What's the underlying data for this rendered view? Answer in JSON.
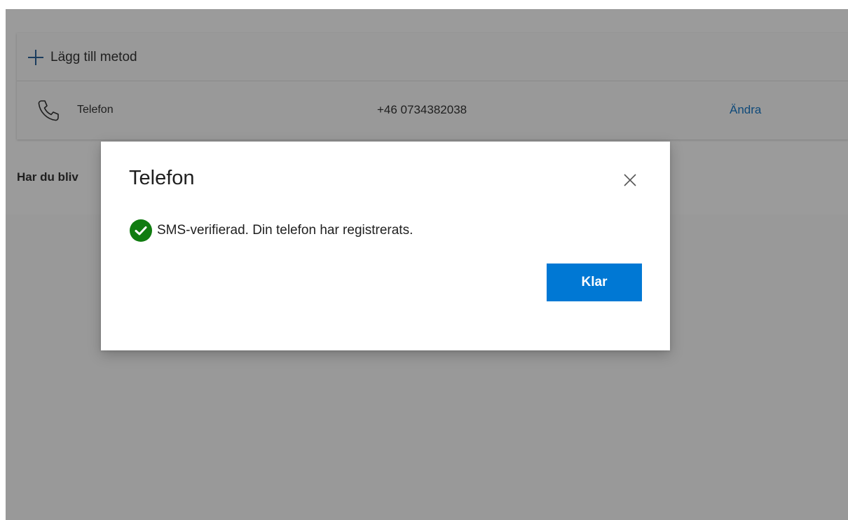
{
  "methods": {
    "add_method_label": "Lägg till metod",
    "rows": [
      {
        "name": "Telefon",
        "value": "+46 0734382038",
        "action": "Ändra",
        "icon": "phone-icon"
      }
    ]
  },
  "lost_device_text": "Har du bliv",
  "dialog": {
    "title": "Telefon",
    "close_icon": "close-icon",
    "status_icon": "checkmark-circle-icon",
    "status_text": "SMS-verifierad. Din telefon har registrerats.",
    "done_label": "Klar"
  },
  "colors": {
    "accent": "#0078d4",
    "success": "#107c10",
    "overlay": "#999999",
    "link": "#0f4a7a"
  }
}
